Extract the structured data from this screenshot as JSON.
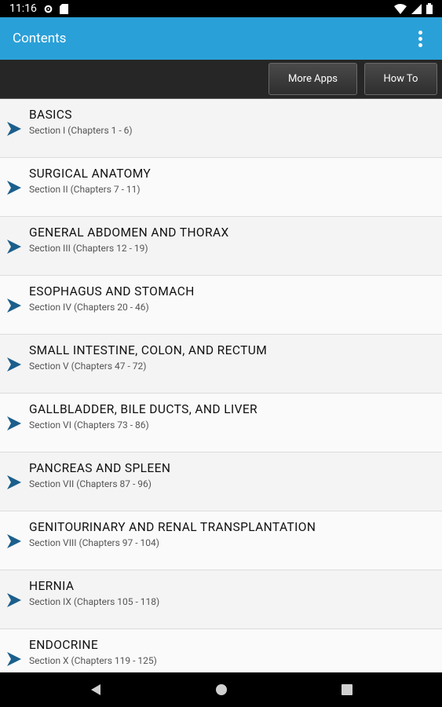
{
  "status": {
    "time": "11:16"
  },
  "appbar": {
    "title": "Contents"
  },
  "toolbar": {
    "more_apps": "More Apps",
    "how_to": "How To"
  },
  "sections": [
    {
      "title": "BASICS",
      "subtitle": "Section I (Chapters 1 - 6)"
    },
    {
      "title": "SURGICAL ANATOMY",
      "subtitle": "Section II (Chapters 7 - 11)"
    },
    {
      "title": "GENERAL ABDOMEN AND THORAX",
      "subtitle": "Section III (Chapters 12 - 19)"
    },
    {
      "title": "ESOPHAGUS AND STOMACH",
      "subtitle": "Section IV (Chapters 20 - 46)"
    },
    {
      "title": "SMALL INTESTINE, COLON, AND RECTUM",
      "subtitle": "Section V (Chapters 47 - 72)"
    },
    {
      "title": "GALLBLADDER, BILE DUCTS, AND LIVER",
      "subtitle": "Section VI (Chapters 73 - 86)"
    },
    {
      "title": "PANCREAS AND SPLEEN",
      "subtitle": "Section VII (Chapters 87 - 96)"
    },
    {
      "title": "GENITOURINARY AND RENAL TRANSPLANTATION",
      "subtitle": "Section VIII (Chapters 97 - 104)"
    },
    {
      "title": "HERNIA",
      "subtitle": "Section IX (Chapters 105 - 118)"
    },
    {
      "title": "ENDOCRINE",
      "subtitle": "Section X (Chapters 119 - 125)"
    }
  ],
  "colors": {
    "appbar": "#2aa0d8",
    "chevron": "#1b5f8c"
  }
}
